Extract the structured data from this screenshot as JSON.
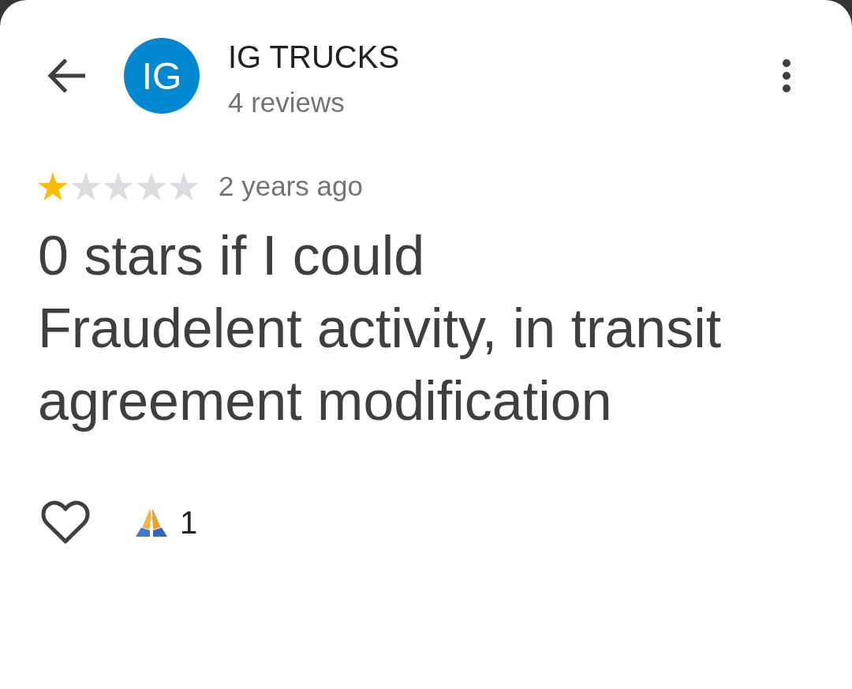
{
  "header": {
    "title": "IG TRUCKS",
    "avatar_initials": "IG",
    "subtitle": "4 reviews"
  },
  "review": {
    "stars": 1,
    "time": "2 years ago",
    "text": "0 stars if I could\nFraudelent activity, in transit agreement modification",
    "liked": false
  },
  "reactions": [
    {
      "kind": "pray",
      "count": "1"
    }
  ]
}
